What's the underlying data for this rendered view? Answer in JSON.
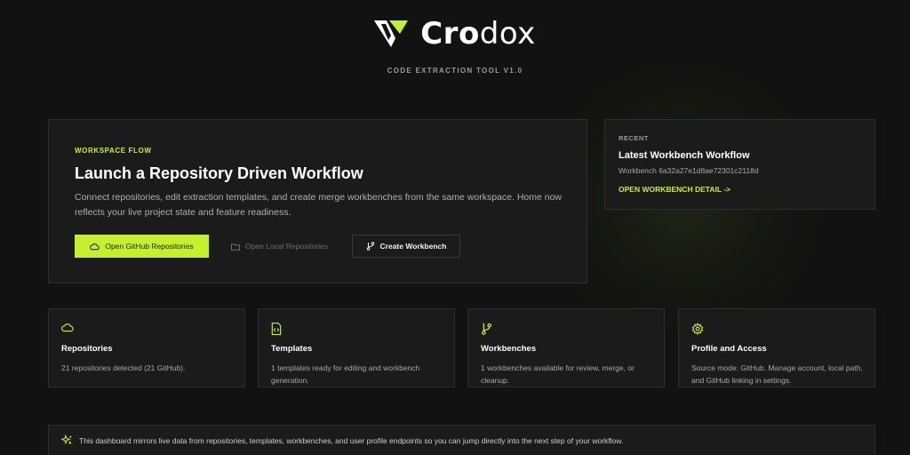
{
  "header": {
    "brand_bold": "Cro",
    "brand_light": "dox",
    "subtitle": "CODE EXTRACTION TOOL V1.0"
  },
  "hero": {
    "eyebrow": "WORKSPACE FLOW",
    "title": "Launch a Repository Driven Workflow",
    "description": "Connect repositories, edit extraction templates, and create merge workbenches from the same workspace. Home now reflects your live project state and feature readiness.",
    "buttons": {
      "github": "Open GitHub Repositories",
      "local": "Open Local Repositories",
      "workbench": "Create Workbench"
    }
  },
  "recent": {
    "label": "RECENT",
    "title": "Latest Workbench Workflow",
    "subtitle": "Workbench 6a32a27e1d8ae72301c2118d",
    "link": "OPEN WORKBENCH DETAIL ->"
  },
  "features": [
    {
      "icon": "cloud-icon",
      "title": "Repositories",
      "description": "21 repositories detected (21 GitHub)."
    },
    {
      "icon": "code-file-icon",
      "title": "Templates",
      "description": "1 templates ready for editing and workbench generation."
    },
    {
      "icon": "git-branch-icon",
      "title": "Workbenches",
      "description": "1 workbenches available for review, merge, or cleanup."
    },
    {
      "icon": "gear-icon",
      "title": "Profile and Access",
      "description": "Source mode: GitHub. Manage account, local path, and GitHub linking in settings."
    }
  ],
  "banner": {
    "icon": "sparkles-icon",
    "text": "This dashboard mirrors live data from repositories, templates, workbenches, and user profile endpoints so you can jump directly into the next step of your workflow."
  },
  "colors": {
    "accent": "#c6f02f",
    "background": "#121212",
    "card": "#1b1b1b",
    "border": "#2e2e2e"
  }
}
